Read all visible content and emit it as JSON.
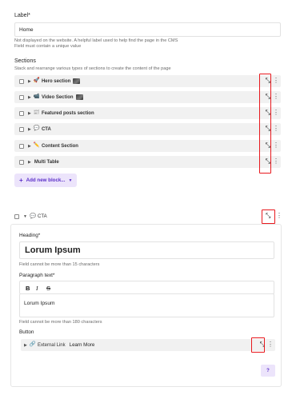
{
  "label_field": {
    "label": "Label*",
    "value": "Home",
    "help": [
      "Not displayed on the website. A helpful label used to help find the page in the CMS",
      "Field must contain a unique value"
    ]
  },
  "sections": {
    "title": "Sections",
    "description": "Stack and rearrange various types of sections to create the content of the page",
    "items": [
      {
        "icon": "🚀",
        "name": "Hero section",
        "has_thumb": true
      },
      {
        "icon": "📹",
        "name": "Video Section",
        "has_thumb": true
      },
      {
        "icon": "📰",
        "name": "Featured posts section",
        "has_thumb": false
      },
      {
        "icon": "💬",
        "name": "CTA",
        "has_thumb": false
      },
      {
        "icon": "✏️",
        "name": "Content Section",
        "has_thumb": false
      },
      {
        "icon": "",
        "name": "Multi Table",
        "has_thumb": false
      }
    ],
    "add_button": "Add new block..."
  },
  "cta_block": {
    "header_icon": "💬",
    "header_name": "CTA",
    "heading_label": "Heading*",
    "heading_value": "Lorum Ipsum",
    "heading_help": "Field cannot be more than 15 characters",
    "paragraph_label": "Paragraph text*",
    "toolbar": {
      "bold": "B",
      "italic": "I",
      "strike": "S"
    },
    "paragraph_value": "Lorum Ipsum",
    "paragraph_help": "Field cannot be more than 180 characters",
    "button_label": "Button",
    "button_row": {
      "icon": "🔗",
      "type": "External Link",
      "text": "Learn More"
    },
    "help_button": "?"
  },
  "colors": {
    "accent": "#5b2fc9",
    "accent_bg": "#ece4fb",
    "highlight": "#e8191e"
  }
}
